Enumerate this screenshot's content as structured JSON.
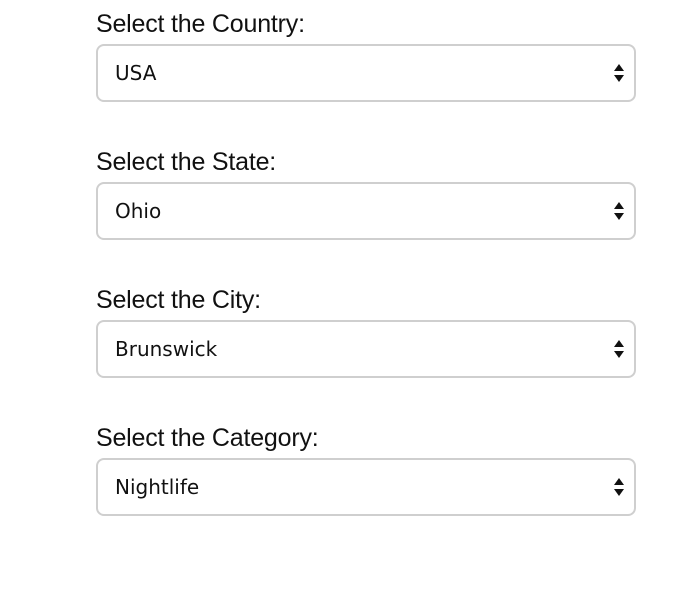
{
  "form": {
    "fields": [
      {
        "label": "Select the Country:",
        "value": "USA",
        "icon": "updown-arrows-icon"
      },
      {
        "label": "Select the State:",
        "value": "Ohio",
        "icon": "updown-arrows-icon"
      },
      {
        "label": "Select the City:",
        "value": "Brunswick",
        "icon": "updown-arrows-icon"
      },
      {
        "label": "Select the Category:",
        "value": "Nightlife",
        "icon": "updown-arrows-icon"
      }
    ]
  },
  "colors": {
    "border": "#cfcfcf",
    "text": "#111111",
    "background": "#ffffff"
  }
}
